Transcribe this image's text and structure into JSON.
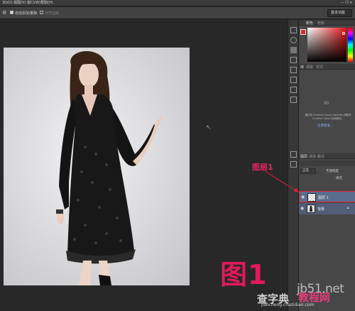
{
  "menubar": {
    "items": [
      "3D(D)",
      "视图(V)",
      "窗口(W)",
      "帮助(H)"
    ]
  },
  "options": {
    "auto_add_mask": "自动添加/删除",
    "align_edges": "对齐边缘",
    "workspace": "基本功能"
  },
  "panels": {
    "color_tabs": [
      "颜色",
      "色板"
    ],
    "lib_tabs": [
      "库",
      "调整",
      "样式"
    ],
    "lib_message": "通过将 Creative Cloud Libraries,请登录 Creative Cloud 应用程序。",
    "lib_login": "立即登录...",
    "layer_tabs": [
      "图层",
      "通道",
      "路径"
    ],
    "blend_mode": "正常",
    "opacity_label": "不透明度",
    "fill_label": "填充",
    "layers": [
      {
        "name": "图层 1",
        "selected": true
      },
      {
        "name": "背景",
        "selected": false
      }
    ]
  },
  "annotation": {
    "layer_label": "图层1",
    "figure_label": "图1"
  },
  "watermark": {
    "url": "jb51.net",
    "site_cn": "教程网",
    "left_cn": "查字典",
    "sub": "jiaocheng.chazidian.com"
  },
  "colors": {
    "accent_pink": "#e01a5a",
    "layer_selected": "#5a6d8e",
    "foreground_swatch": "#d42a2a"
  }
}
